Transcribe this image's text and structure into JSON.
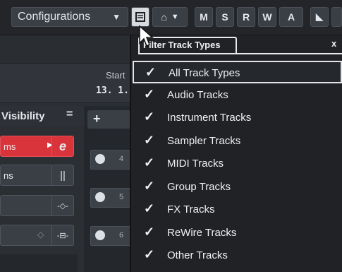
{
  "toolbar": {
    "config_label": "Configurations",
    "buttons": {
      "m": "M",
      "s": "S",
      "r": "R",
      "w": "W",
      "a": "A"
    }
  },
  "ruler": {
    "start_label": "Start",
    "start_value": "13. 1."
  },
  "visibility": {
    "title": "Visibility",
    "menu_glyph": "=",
    "rows": [
      {
        "text": "ms",
        "icon": "e"
      },
      {
        "text": "ns",
        "icon": "||"
      },
      {
        "text": "",
        "icon": "-◇-"
      },
      {
        "text": "",
        "icon": "-⊟-"
      }
    ]
  },
  "tracklist": {
    "add_glyph": "+",
    "tracks": [
      {
        "num": "4"
      },
      {
        "num": "5"
      },
      {
        "num": "6"
      }
    ]
  },
  "filter_menu": {
    "title": "Filter Track Types",
    "close": "x",
    "check_glyph": "✓",
    "items": [
      "All Track Types",
      "Audio Tracks",
      "Instrument Tracks",
      "Sampler Tracks",
      "MIDI Tracks",
      "Group Tracks",
      "FX Tracks",
      "ReWire Tracks",
      "Other Tracks"
    ],
    "selected_index": 0
  }
}
